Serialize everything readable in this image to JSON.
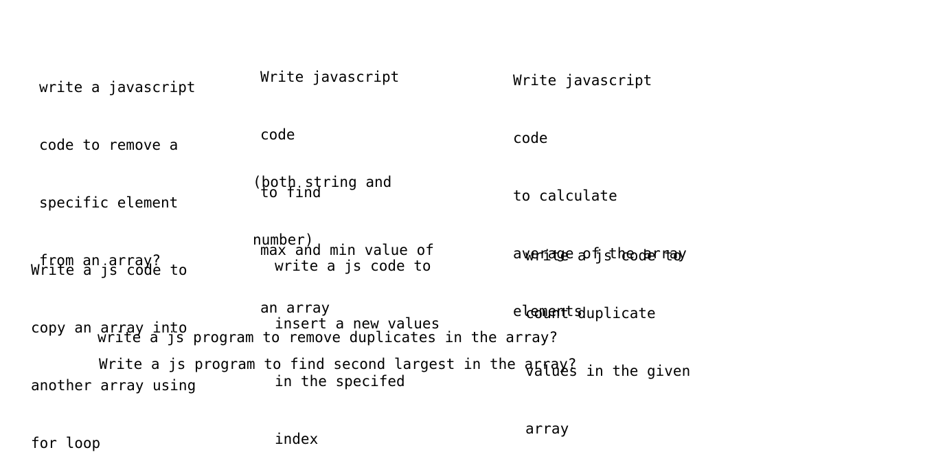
{
  "notes": {
    "remove_element": [
      "write a javascript",
      "code to remove a",
      "specific element",
      "from an array?"
    ],
    "max_min": [
      "Write javascript",
      "code",
      "to find",
      "max and min value of",
      "an array"
    ],
    "max_min_sub": [
      "(both string and",
      "number)"
    ],
    "average": [
      "Write javascript",
      "code",
      "to calculate",
      "average of the array",
      "elements"
    ],
    "copy_array": [
      "Write a js code to",
      "copy an array into",
      "another array using",
      "for loop"
    ],
    "insert_value": [
      "write a js code to",
      "insert a new values",
      "in the specifed",
      "index"
    ],
    "count_duplicates": [
      "write a js code to",
      "count duplicate",
      "values in the given",
      "array"
    ],
    "remove_duplicates": "write a js program to remove duplicates in the array?",
    "second_largest": "Write a js program to find second largest in the array?"
  }
}
